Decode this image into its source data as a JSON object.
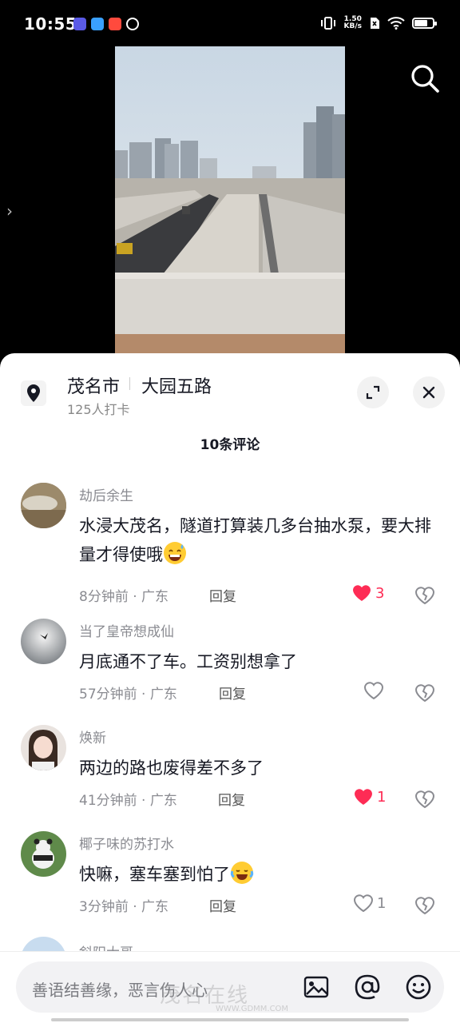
{
  "status_bar": {
    "time": "10:55",
    "net_speed_value": "1.50",
    "net_speed_unit": "KB/s"
  },
  "video": {
    "search_icon": "search-icon"
  },
  "location": {
    "city": "茂名市",
    "road": "大园五路",
    "checkins": "125人打卡"
  },
  "comment_count": "10条评论",
  "comments": [
    {
      "user": "劫后余生",
      "text": "水浸大茂名，隧道打算装几多台抽水泵，要大排量才得使哦",
      "emoji": "sweat-smile-emoji",
      "time": "8分钟前",
      "region": "广东",
      "reply": "回复",
      "likes": "3",
      "liked": true
    },
    {
      "user": "当了皇帝想成仙",
      "text": "月底通不了车。工资别想拿了",
      "time": "57分钟前",
      "region": "广东",
      "reply": "回复",
      "likes": "",
      "liked": false
    },
    {
      "user": "焕新",
      "text": "两边的路也废得差不多了",
      "time": "41分钟前",
      "region": "广东",
      "reply": "回复",
      "likes": "1",
      "liked": true
    },
    {
      "user": "椰子味的苏打水",
      "text": "快嘛，塞车塞到怕了",
      "emoji": "cry-laugh-emoji",
      "time": "3分钟前",
      "region": "广东",
      "reply": "回复",
      "likes": "1",
      "liked": false
    },
    {
      "user": "斜阳大哥"
    }
  ],
  "meta_separator": " · ",
  "input": {
    "placeholder": "善语结善缘，恶言伤人心"
  },
  "watermark": {
    "text": "茂名在线",
    "url": "WWW.GDMM.COM"
  },
  "colors": {
    "like_red": "#fe2c55",
    "text_dark": "#161823",
    "text_gray": "#8a8b91"
  }
}
